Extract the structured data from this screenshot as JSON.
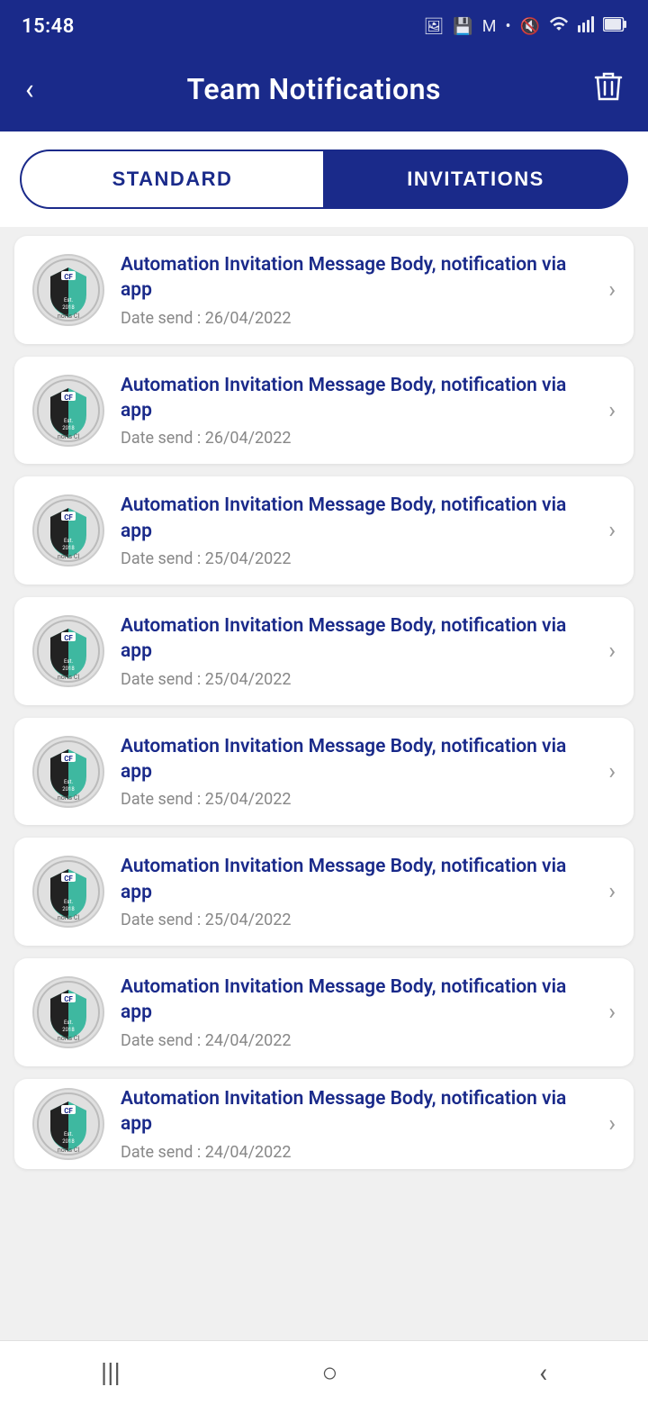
{
  "statusBar": {
    "time": "15:48",
    "icons": [
      "image",
      "save",
      "gmail",
      "dot",
      "mute",
      "wifi",
      "signal",
      "battery"
    ]
  },
  "header": {
    "title": "Team Notifications",
    "backLabel": "‹",
    "deleteLabel": "🗑"
  },
  "tabs": {
    "standard": "STANDARD",
    "invitations": "INVITATIONS",
    "activeTab": "invitations"
  },
  "notifications": [
    {
      "title": "Automation Invitation Message Body, notification via app",
      "date": "Date send : 26/04/2022"
    },
    {
      "title": "Automation Invitation Message Body, notification via app",
      "date": "Date send : 26/04/2022"
    },
    {
      "title": "Automation Invitation Message Body, notification via app",
      "date": "Date send : 25/04/2022"
    },
    {
      "title": "Automation Invitation Message Body, notification via app",
      "date": "Date send : 25/04/2022"
    },
    {
      "title": "Automation Invitation Message Body, notification via app",
      "date": "Date send : 25/04/2022"
    },
    {
      "title": "Automation Invitation Message Body, notification via app",
      "date": "Date send : 25/04/2022"
    },
    {
      "title": "Automation Invitation Message Body, notification via app",
      "date": "Date send : 24/04/2022"
    },
    {
      "title": "Automation Invitation Message Body, notification via app",
      "date": "Date send : 24/04/2022",
      "partial": true
    }
  ],
  "bottomNav": {
    "menu": "|||",
    "home": "○",
    "back": "‹"
  },
  "colors": {
    "primary": "#1a2a8a",
    "teal": "#3eb8a0",
    "background": "#f0f0f0",
    "white": "#ffffff",
    "textGray": "#888888"
  }
}
